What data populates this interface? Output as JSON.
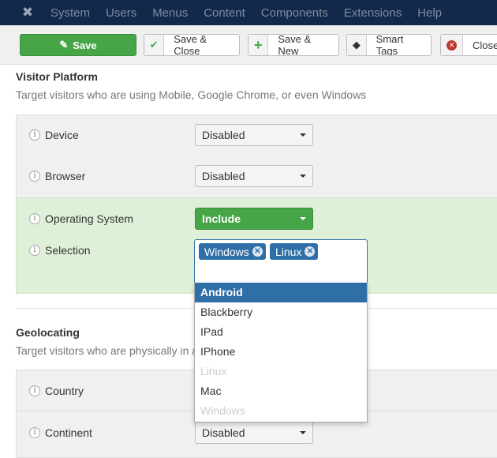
{
  "nav": {
    "items": [
      "System",
      "Users",
      "Menus",
      "Content",
      "Components",
      "Extensions",
      "Help"
    ]
  },
  "toolbar": {
    "save": "Save",
    "save_close": "Save & Close",
    "save_new": "Save & New",
    "smart_tags": "Smart Tags",
    "close": "Close"
  },
  "platform": {
    "title": "Visitor Platform",
    "desc": "Target visitors who are using Mobile, Google Chrome, or even Windows",
    "device": {
      "label": "Device",
      "value": "Disabled"
    },
    "browser": {
      "label": "Browser",
      "value": "Disabled"
    },
    "os": {
      "label": "Operating System",
      "value": "Include"
    },
    "selection": {
      "label": "Selection",
      "tags": [
        "Windows",
        "Linux"
      ]
    }
  },
  "dropdown": {
    "options": [
      {
        "label": "Android",
        "state": "highlighted"
      },
      {
        "label": "Blackberry"
      },
      {
        "label": "IPad"
      },
      {
        "label": "IPhone"
      },
      {
        "label": "Linux",
        "state": "disabled"
      },
      {
        "label": "Mac"
      },
      {
        "label": "Windows",
        "state": "disabled"
      }
    ]
  },
  "geo": {
    "title": "Geolocating",
    "desc": "Target visitors who are physically in a s",
    "country": {
      "label": "Country"
    },
    "continent": {
      "label": "Continent",
      "value": "Disabled"
    }
  },
  "colors": {
    "navbar": "#13294b",
    "success": "#46a546",
    "primary": "#2f6fa7",
    "include_bg": "#dff0d8"
  }
}
